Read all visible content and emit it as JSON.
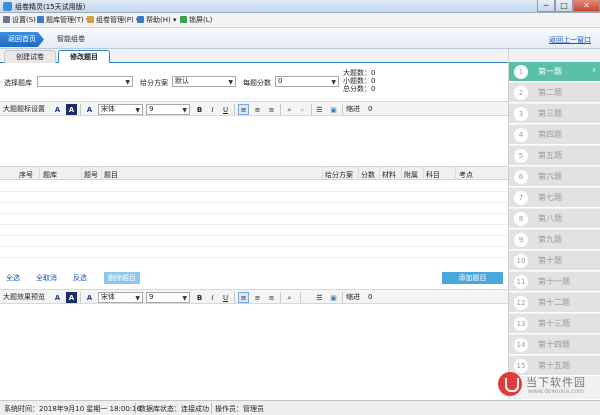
{
  "window": {
    "title": "组卷精灵(15天试用版)",
    "min": "─",
    "max": "□",
    "close": "✕"
  },
  "menu": [
    {
      "label": "设置(S)",
      "icon": "gear-icon",
      "color": "#6b7b8c"
    },
    {
      "label": "题库管理(T)",
      "icon": "database-icon",
      "color": "#3f78c4"
    },
    {
      "label": "组卷管理(P)",
      "icon": "folder-icon",
      "color": "#d9a03a"
    },
    {
      "label": "帮助(H)",
      "icon": "help-icon",
      "color": "#3f78c4"
    },
    {
      "label": "锁屏(L)",
      "icon": "lock-icon",
      "color": "#3aa14a"
    }
  ],
  "nav": {
    "home": "返回首页",
    "smart": "智能组卷",
    "back": "返回上一窗口"
  },
  "tabs": {
    "create": "创建试卷",
    "edit": "修改题目"
  },
  "filters": {
    "bank_label": "选择题库",
    "bank_value": "",
    "scheme_label": "给分方案",
    "scheme_value": "默认",
    "score_label": "每题分数",
    "score_value": "0",
    "count_big": "大题数：0",
    "count_small": "小题数：0",
    "count_total": "总分数：0"
  },
  "toolbar1": {
    "label": "大题题标设置",
    "font": "宋体",
    "size": "9",
    "bold": "B",
    "italic": "I",
    "underline": "U",
    "indent_label": "缩进",
    "indent_value": "0"
  },
  "toolbar2": {
    "label": "大题效果预览",
    "font": "宋体",
    "size": "9",
    "bold": "B",
    "italic": "I",
    "underline": "U",
    "indent_label": "缩进",
    "indent_value": "0"
  },
  "table_headers": [
    "序号",
    "题库",
    "题号",
    "题目",
    "给分方案",
    "分数",
    "材料",
    "附属",
    "科目",
    "考点"
  ],
  "actions": {
    "select_all": "全选",
    "deselect": "全取消",
    "invert": "反选",
    "delete": "删除题目",
    "add": "添加题目"
  },
  "questions": [
    "第一题",
    "第二题",
    "第三题",
    "第四题",
    "第五题",
    "第六题",
    "第七题",
    "第八题",
    "第九题",
    "第十题",
    "第十一题",
    "第十二题",
    "第十三题",
    "第十四题",
    "第十五题"
  ],
  "active_question": 0,
  "watermark": {
    "name": "当下软件园",
    "url": "www.downxia.com"
  },
  "status": {
    "time": "系统时间：2018年9月10 星期一 18:00:16",
    "db": "数据库状态：连接成功",
    "operator": "操作员：管理员"
  },
  "colors": {
    "accent": "#2e86c1",
    "active_question": "#5ac1a8",
    "add_button": "#4aa7dc"
  }
}
